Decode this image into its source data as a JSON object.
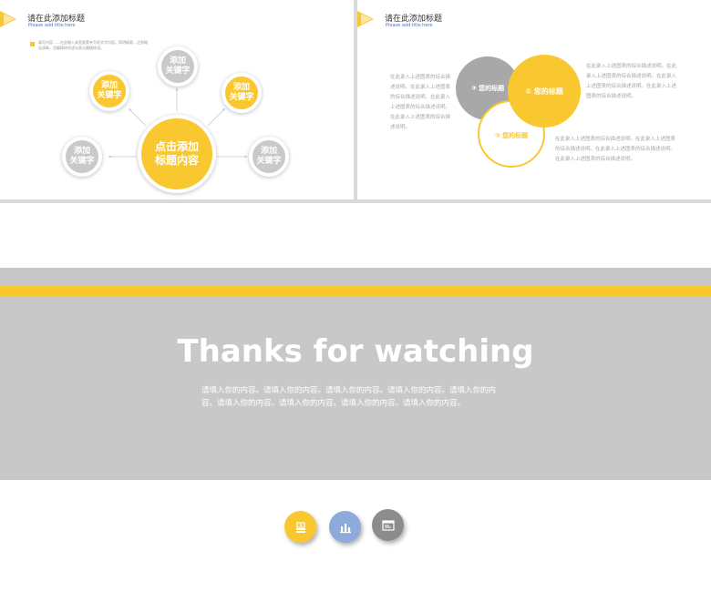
{
  "slide1": {
    "title": "请在此添加标题",
    "subtitle": "Please add title here",
    "note": "填写内容……在此输入具宽要素亲写的文字内容。简明精要，达到概念清晰，用最精炼的语句表达最精炼语。",
    "center": {
      "line1": "点击添加",
      "line2": "标题内容"
    },
    "keywords": [
      {
        "line1": "添加",
        "line2": "关键字"
      },
      {
        "line1": "添加",
        "line2": "关键字"
      },
      {
        "line1": "添加",
        "line2": "关键字"
      },
      {
        "line1": "添加",
        "line2": "关键字"
      },
      {
        "line1": "添加",
        "line2": "关键字"
      }
    ],
    "colors": {
      "yellow": "#f9c830",
      "gray": "#c9c9c9"
    }
  },
  "slide2": {
    "title": "请在此添加标题",
    "subtitle": "Please add title here",
    "venn": [
      {
        "label": "③ 您的标题"
      },
      {
        "label": "① 您的标题"
      },
      {
        "label": "② 您的标题"
      }
    ],
    "left_para": "在此录入上述图表的综合描述说明。在此录入上述图表的综合描述说明。在此录入上述图表的综合描述说明。在此录入上述图表的综合描述说明。",
    "right_para_top": "在此录入上述图表的综合描述说明。在此录入上述图表的综合描述说明。在此录入上述图表的综合描述说明。在此录入上述图表的综合描述说明。",
    "right_para_bottom": "在此录入上述图表的综合描述说明。在此录入上述图表的综合描述说明。在此录入上述图表的综合描述说明。在此录入上述图表的综合描述说明。"
  },
  "slide3": {
    "heading": "Thanks for watching",
    "body": "请填入你的内容。请填入你的内容。请填入你的内容。请填入你的内容。请填入你的内容。请填入你的内容。请填入你的内容。请填入你的内容。请填入你的内容。",
    "icons": [
      {
        "name": "money-stack-icon",
        "color": "#f9c830"
      },
      {
        "name": "bar-chart-icon",
        "color": "#8eaadb"
      },
      {
        "name": "browser-window-icon",
        "color": "#8c8c8c"
      }
    ]
  }
}
